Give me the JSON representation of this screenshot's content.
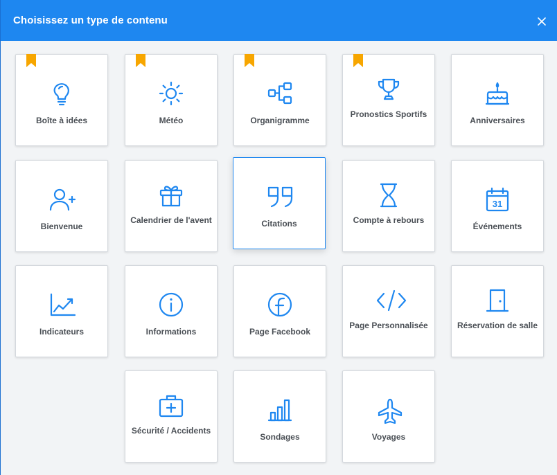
{
  "dialog": {
    "title": "Choisissez un type de contenu"
  },
  "colors": {
    "header": "#1e87f0",
    "icon": "#1e87f0",
    "bookmark": "#f7a600",
    "label": "#4a4f55"
  },
  "tiles": [
    {
      "label": "Boîte à idées",
      "icon": "lightbulb-icon",
      "bookmarked": true
    },
    {
      "label": "Météo",
      "icon": "sun-icon",
      "bookmarked": true
    },
    {
      "label": "Organigramme",
      "icon": "org-chart-icon",
      "bookmarked": true
    },
    {
      "label": "Pronostics Sportifs",
      "icon": "trophy-icon",
      "bookmarked": true
    },
    {
      "label": "Anniversaires",
      "icon": "birthday-cake-icon",
      "bookmarked": false
    },
    {
      "label": "Bienvenue",
      "icon": "user-plus-icon",
      "bookmarked": false
    },
    {
      "label": "Calendrier de l'avent",
      "icon": "gift-icon",
      "bookmarked": false
    },
    {
      "label": "Citations",
      "icon": "quote-icon",
      "bookmarked": false,
      "selected": true
    },
    {
      "label": "Compte à rebours",
      "icon": "hourglass-icon",
      "bookmarked": false
    },
    {
      "label": "Événements",
      "icon": "calendar-icon",
      "bookmarked": false,
      "icon_text": "31"
    },
    {
      "label": "Indicateurs",
      "icon": "chart-line-icon",
      "bookmarked": false
    },
    {
      "label": "Informations",
      "icon": "info-icon",
      "bookmarked": false
    },
    {
      "label": "Page Facebook",
      "icon": "facebook-icon",
      "bookmarked": false
    },
    {
      "label": "Page Personnalisée",
      "icon": "code-icon",
      "bookmarked": false
    },
    {
      "label": "Réservation de salle",
      "icon": "door-icon",
      "bookmarked": false
    },
    {
      "label": "Sécurité / Accidents",
      "icon": "first-aid-kit-icon",
      "bookmarked": false
    },
    {
      "label": "Sondages",
      "icon": "bar-chart-icon",
      "bookmarked": false
    },
    {
      "label": "Voyages",
      "icon": "airplane-icon",
      "bookmarked": false
    }
  ]
}
